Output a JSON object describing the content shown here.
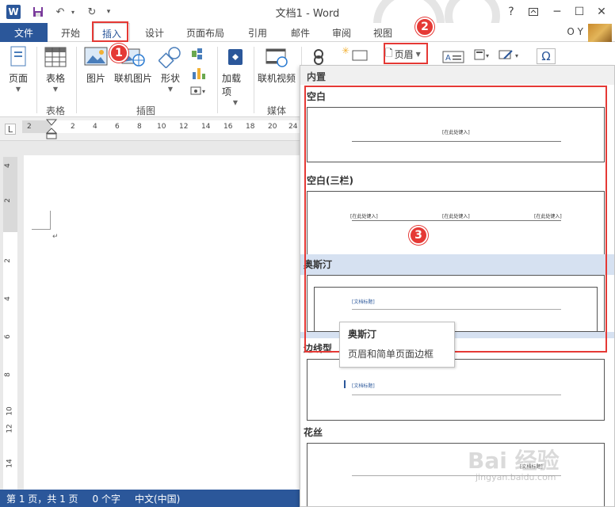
{
  "window": {
    "app_icon": "W",
    "title": "文档1 - Word",
    "help": "?",
    "user": "O Y"
  },
  "tabs": [
    "文件",
    "开始",
    "插入",
    "设计",
    "页面布局",
    "引用",
    "邮件",
    "审阅",
    "视图"
  ],
  "ribbon": {
    "buttons": [
      {
        "label": "页面",
        "icon": "pages-icon"
      },
      {
        "label": "表格",
        "icon": "table-icon"
      },
      {
        "label": "图片",
        "icon": "picture-icon"
      },
      {
        "label": "联机图片",
        "icon": "online-picture-icon"
      },
      {
        "label": "形状",
        "icon": "shapes-icon"
      },
      {
        "label": "加载项",
        "icon": "addins-icon"
      },
      {
        "label": "联机视频",
        "icon": "online-video-icon"
      },
      {
        "label": "页眉",
        "icon": "header-icon"
      }
    ],
    "groups": [
      "表格",
      "插图",
      "媒体"
    ],
    "symbol": "Ω"
  },
  "ruler": {
    "numbers": [
      "2",
      "2",
      "4",
      "6",
      "8",
      "10",
      "12",
      "14",
      "16",
      "18",
      "20",
      "24"
    ],
    "vnumbers": [
      "4",
      "2",
      "2",
      "4",
      "6",
      "8",
      "10",
      "12",
      "14"
    ]
  },
  "statusbar": {
    "page": "第 1 页，共 1 页",
    "words": "0 个字",
    "language": "中文(中国)"
  },
  "gallery": {
    "heading": "内置",
    "sections": [
      {
        "title": "空白",
        "placeholders": [
          "[在此处键入]"
        ]
      },
      {
        "title": "空白(三栏)",
        "placeholders": [
          "[在此处键入]",
          "[在此处键入]",
          "[在此处键入]"
        ]
      },
      {
        "title": "奥斯汀",
        "placeholders": [
          "[文档标题]"
        ]
      },
      {
        "title": "边线型",
        "placeholders": [
          "[文档标题]"
        ]
      },
      {
        "title": "花丝",
        "placeholders": [
          "[文档标题]"
        ]
      }
    ]
  },
  "tooltip": {
    "title": "奥斯汀",
    "description": "页眉和简单页面边框"
  },
  "callouts": [
    "1",
    "2",
    "3"
  ],
  "watermark": {
    "logo": "Bai 经验",
    "url": "jingyan.baidu.com"
  }
}
